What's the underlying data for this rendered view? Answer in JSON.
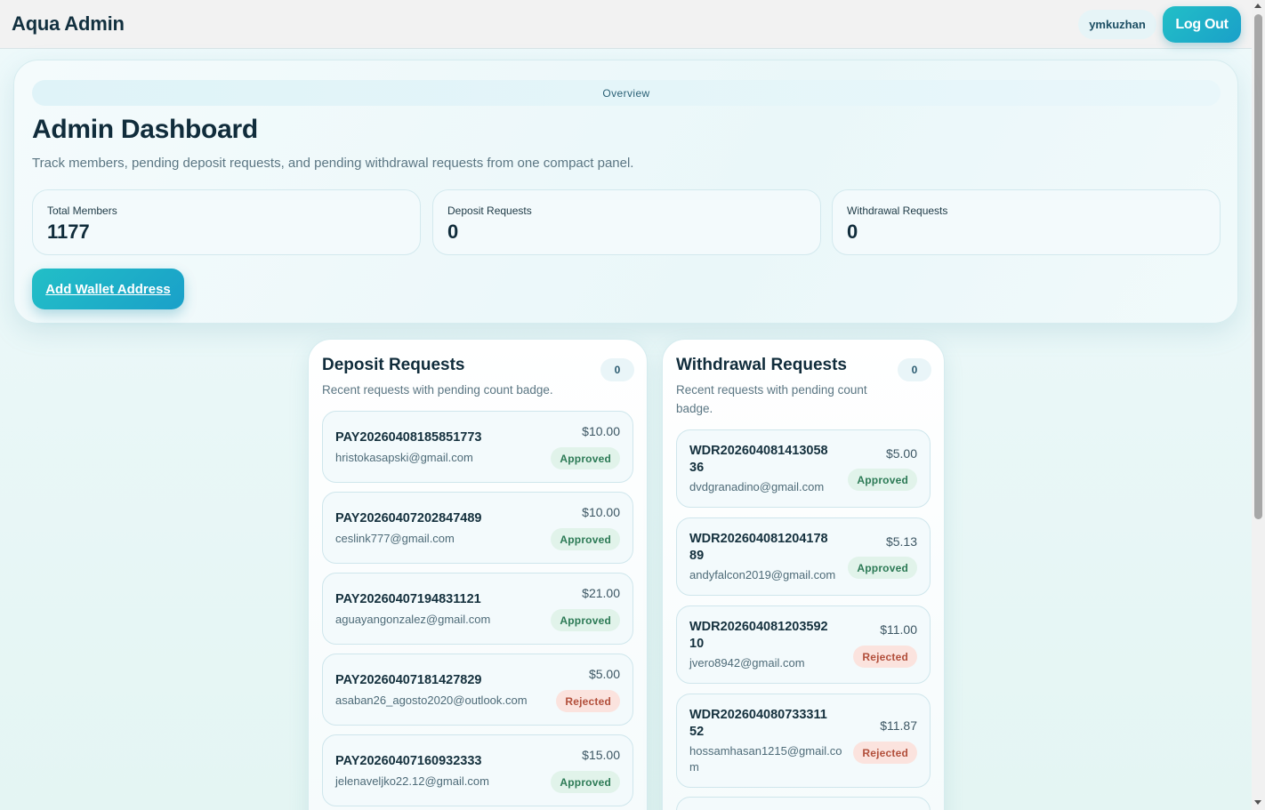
{
  "app": {
    "brand": "Aqua Admin",
    "user": "ymkuzhan",
    "logout_label": "Log Out"
  },
  "hero": {
    "overview_label": "Overview",
    "title": "Admin Dashboard",
    "subtitle": "Track members, pending deposit requests, and pending withdrawal requests from one compact panel.",
    "stats": [
      {
        "label": "Total Members",
        "value": "1177"
      },
      {
        "label": "Deposit Requests",
        "value": "0"
      },
      {
        "label": "Withdrawal Requests",
        "value": "0"
      }
    ],
    "add_wallet_label": "Add Wallet Address"
  },
  "deposit": {
    "title": "Deposit Requests",
    "subtitle": "Recent requests with pending count badge.",
    "count": "0",
    "items": [
      {
        "id": "PAY20260408185851773",
        "email": "hristokasapski@gmail.com",
        "amount": "$10.00",
        "status": "Approved"
      },
      {
        "id": "PAY20260407202847489",
        "email": "ceslink777@gmail.com",
        "amount": "$10.00",
        "status": "Approved"
      },
      {
        "id": "PAY20260407194831121",
        "email": "aguayangonzalez@gmail.com",
        "amount": "$21.00",
        "status": "Approved"
      },
      {
        "id": "PAY20260407181427829",
        "email": "asaban26_agosto2020@outlook.com",
        "amount": "$5.00",
        "status": "Rejected"
      },
      {
        "id": "PAY20260407160932333",
        "email": "jelenaveljko22.12@gmail.com",
        "amount": "$15.00",
        "status": "Approved"
      }
    ]
  },
  "withdrawal": {
    "title": "Withdrawal Requests",
    "subtitle_lines": [
      "Recent requests with pending count",
      "badge."
    ],
    "count": "0",
    "items": [
      {
        "id_lines": [
          "WDR202604081413058",
          "36"
        ],
        "email_lines": [
          "dvdgranadino@gmail.com"
        ],
        "amount": "$5.00",
        "status": "Approved"
      },
      {
        "id_lines": [
          "WDR202604081204178",
          "89"
        ],
        "email_lines": [
          "andyfalcon2019@gmail.com"
        ],
        "amount": "$5.13",
        "status": "Approved"
      },
      {
        "id_lines": [
          "WDR202604081203592",
          "10"
        ],
        "email_lines": [
          "jvero8942@gmail.com"
        ],
        "amount": "$11.00",
        "status": "Rejected"
      },
      {
        "id_lines": [
          "WDR202604080733311",
          "52"
        ],
        "email_lines": [
          "hossamhasan1215@gmail.co",
          "m"
        ],
        "amount": "$11.87",
        "status": "Rejected"
      }
    ]
  },
  "colors": {
    "accent_start": "#22bfc7",
    "accent_end": "#1aa0c9",
    "approved_bg": "#e1f3ea",
    "approved_text": "#2c7a55",
    "rejected_bg": "#fbe3de",
    "rejected_text": "#b24f3b"
  }
}
